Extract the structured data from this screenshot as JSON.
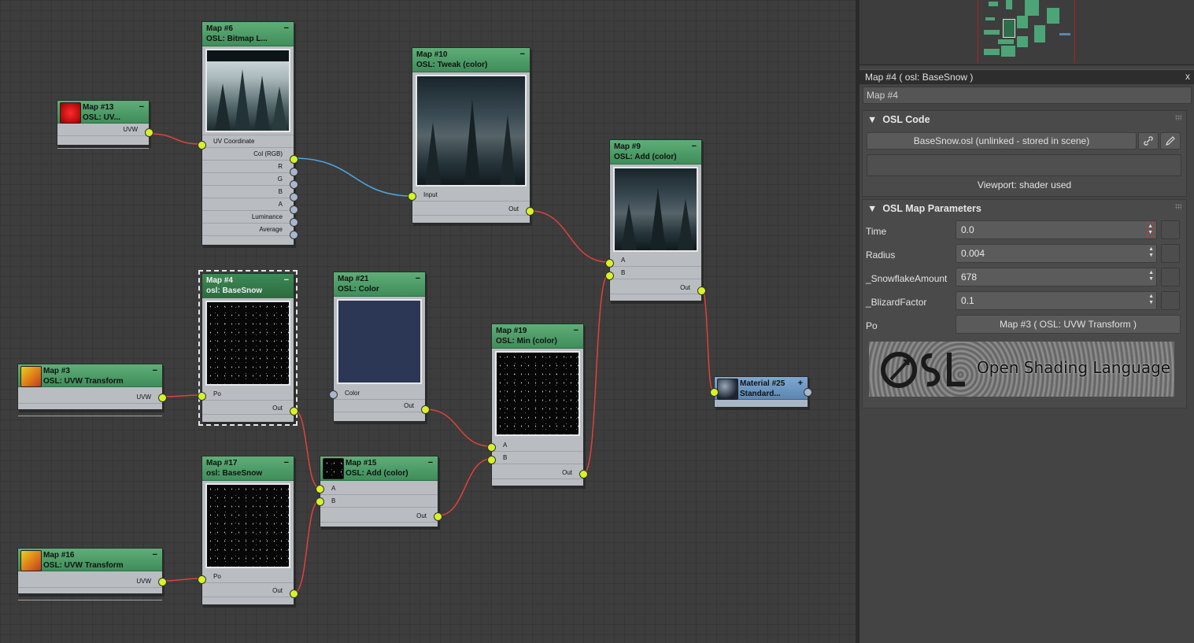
{
  "nodes": {
    "map6": {
      "title": "Map #6",
      "subtitle": "OSL: Bitmap L...",
      "rows": [
        "UV Coordinate",
        "Col (RGB)",
        "R",
        "G",
        "B",
        "A",
        "Luminance",
        "Average"
      ]
    },
    "map13": {
      "title": "Map #13",
      "subtitle": "OSL: UV...",
      "rows": [
        "UVW"
      ]
    },
    "map10": {
      "title": "Map #10",
      "subtitle": "OSL: Tweak (color)",
      "rows": [
        "Input",
        "Out"
      ]
    },
    "map9": {
      "title": "Map #9",
      "subtitle": "OSL: Add (color)",
      "rows": [
        "A",
        "B",
        "Out"
      ]
    },
    "map4": {
      "title": "Map #4",
      "subtitle": "osl: BaseSnow",
      "rows": [
        "Po",
        "Out"
      ]
    },
    "map21": {
      "title": "Map #21",
      "subtitle": "OSL: Color",
      "rows": [
        "Color",
        "Out"
      ]
    },
    "map3": {
      "title": "Map #3",
      "subtitle": "OSL: UVW Transform",
      "rows": [
        "UVW"
      ]
    },
    "map19": {
      "title": "Map #19",
      "subtitle": "OSL: Min (color)",
      "rows": [
        "A",
        "B",
        "Out"
      ]
    },
    "map17": {
      "title": "Map #17",
      "subtitle": "osl: BaseSnow",
      "rows": [
        "Po",
        "Out"
      ]
    },
    "map15": {
      "title": "Map #15",
      "subtitle": "OSL: Add (color)",
      "rows": [
        "A",
        "B",
        "Out"
      ]
    },
    "map16": {
      "title": "Map #16",
      "subtitle": "OSL: UVW Transform",
      "rows": [
        "UVW"
      ]
    },
    "mat25": {
      "title": "Material #25",
      "subtitle": "Standard...",
      "plus": "+"
    }
  },
  "minimize_glyph": "−",
  "colors": {
    "node_header": "#4f9e69",
    "socket_connected": "#d7f228",
    "socket_free": "#a9b6cc",
    "wire_red": "#e0413a",
    "wire_blue": "#4aa7e6",
    "material_header": "#6f9bc4"
  },
  "panel": {
    "title": "Map #4  ( osl: BaseSnow )",
    "close": "x",
    "name_value": "Map #4",
    "osl_code": {
      "title": "OSL Code",
      "file_button": "BaseSnow.osl (unlinked - stored in scene)",
      "link_icon": "link-icon",
      "edit_icon": "pencil-icon",
      "viewport_label": "Viewport: shader used"
    },
    "params": {
      "title": "OSL Map Parameters",
      "items": [
        {
          "label": "Time",
          "value": "0.0"
        },
        {
          "label": "Radius",
          "value": "0.004"
        },
        {
          "label": "_SnowflakeAmount",
          "value": "678"
        },
        {
          "label": "_BlizardFactor",
          "value": "0.1"
        }
      ],
      "po_label": "Po",
      "po_button": "Map #3  ( OSL: UVW Transform )"
    },
    "logo_text": "Open Shading Language",
    "logo_mark": "OSL"
  }
}
